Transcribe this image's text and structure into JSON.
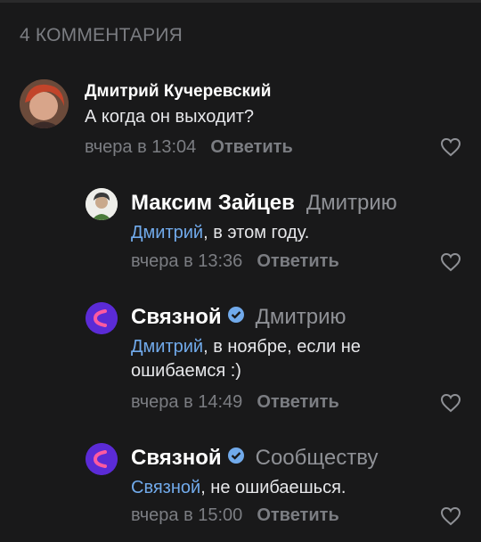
{
  "header": {
    "count_label": "4 КОММЕНТАРИЯ"
  },
  "comments": [
    {
      "author": "Дмитрий Кучеревский",
      "text": "А когда он выходит?",
      "date": "вчера в 13:04",
      "reply_label": "Ответить"
    },
    {
      "author": "Максим Зайцев",
      "reply_to": "Дмитрию",
      "mention": "Дмитрий",
      "text": ", в этом году.",
      "date": "вчера в 13:36",
      "reply_label": "Ответить"
    },
    {
      "author": "Связной",
      "reply_to": "Дмитрию",
      "mention": "Дмитрий",
      "text_line1": ", в ноябре, если не",
      "text_line2": "ошибаемся :)",
      "date": "вчера в 14:49",
      "reply_label": "Ответить"
    },
    {
      "author": "Связной",
      "reply_to": "Сообществу",
      "mention": "Связной",
      "text": ", не ошибаешься.",
      "date": "вчера в 15:00",
      "reply_label": "Ответить"
    }
  ],
  "colors": {
    "background": "#19191a",
    "link": "#71aaeb",
    "secondary": "#7b7d82",
    "brand": "#5b2bd6"
  }
}
